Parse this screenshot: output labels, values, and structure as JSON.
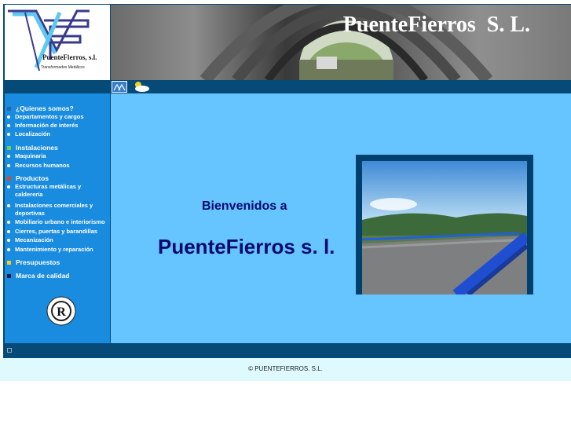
{
  "brand": {
    "logo_name": "PuenteFierros, s.l.",
    "logo_tagline": "Transformados Metálicos",
    "banner_title": "PuenteFierros  S. L."
  },
  "nav": {
    "items": [
      {
        "label": "¿Quienes somos?",
        "bullet": "square",
        "color": "#2d5fb0"
      },
      {
        "label": "Departamentos y cargos",
        "bullet": "dot"
      },
      {
        "label": "Información de interés",
        "bullet": "dot"
      },
      {
        "label": "Localización",
        "bullet": "dot"
      },
      {
        "label": "Instalaciones",
        "bullet": "square",
        "color": "#6fcf4f"
      },
      {
        "label": "Maquinaria",
        "bullet": "dot"
      },
      {
        "label": "Recursos humanos",
        "bullet": "dot"
      },
      {
        "label": "Productos",
        "bullet": "square",
        "color": "#e0481c"
      },
      {
        "label": "Estructuras metálicas y calderería",
        "bullet": "dot"
      },
      {
        "label": "Instalaciones comerciales y deportivas",
        "bullet": "dot"
      },
      {
        "label": "Mobiliario urbano e interiorismo",
        "bullet": "dot"
      },
      {
        "label": "Cierres, puertas y barandillas",
        "bullet": "dot"
      },
      {
        "label": "Mecanización",
        "bullet": "dot"
      },
      {
        "label": "Mantenimiento y reparación",
        "bullet": "dot"
      },
      {
        "label": "Presupuestos",
        "bullet": "square",
        "color": "#f2d21c"
      },
      {
        "label": "Marca de calidad",
        "bullet": "square",
        "color": "#0a1a4a"
      }
    ]
  },
  "main": {
    "welcome": "Bienvenidos a",
    "company": "PuenteFierros s. l."
  },
  "footer": {
    "copyright": "© PUENTEFIERROS. S.L."
  },
  "icons": [
    "home-icon",
    "weather-icon",
    "quality-seal-icon",
    "small-link-icon"
  ]
}
